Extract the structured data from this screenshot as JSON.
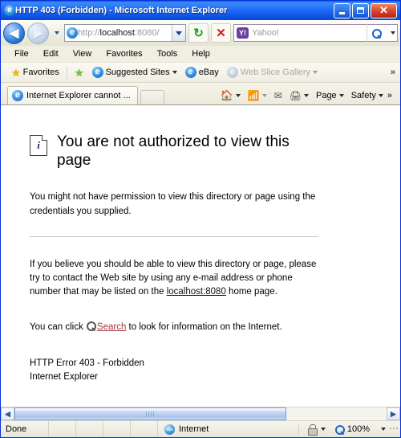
{
  "window": {
    "title": "HTTP 403 (Forbidden) - Microsoft Internet Explorer",
    "minimize_label": "Minimize",
    "maximize_label": "Maximize",
    "close_label": "Close"
  },
  "nav": {
    "back_glyph": "◀",
    "forward_glyph": "▶",
    "refresh_glyph": "↻",
    "stop_glyph": "✕",
    "address_prefix": "http://",
    "address_host": "localhost",
    "address_suffix": ":8080/"
  },
  "search": {
    "provider_badge": "Y!",
    "placeholder": "Yahoo!"
  },
  "menu": {
    "items": [
      "File",
      "Edit",
      "View",
      "Favorites",
      "Tools",
      "Help"
    ]
  },
  "favorites_bar": {
    "favorites_label": "Favorites",
    "items": [
      {
        "label": "Suggested Sites",
        "dim": false
      },
      {
        "label": "eBay",
        "dim": false
      },
      {
        "label": "Web Slice Gallery",
        "dim": true
      }
    ],
    "overflow_glyph": "»"
  },
  "tabs": {
    "active_tab_label": "Internet Explorer cannot ...",
    "new_tab_label": ""
  },
  "command_bar": {
    "home_label": "",
    "feeds_label": "",
    "mail_label": "",
    "print_label": "",
    "page_label": "Page",
    "safety_label": "Safety",
    "overflow_glyph": "»"
  },
  "page": {
    "heading": "You are not authorized to view this page",
    "paragraph_1": "You might not have permission to view this directory or page using the credentials you supplied.",
    "paragraph_2_before": "If you believe you should be able to view this directory or page, please try to contact the Web site by using any e-mail address or phone number that may be listed on the ",
    "paragraph_2_link": "localhost:8080",
    "paragraph_2_after": " home page.",
    "paragraph_3_before": "You can click ",
    "paragraph_3_link": "Search",
    "paragraph_3_after": " to look for information on the Internet.",
    "error_code": "HTTP Error 403 - Forbidden",
    "error_agent": "Internet Explorer"
  },
  "status_bar": {
    "status_text": "Done",
    "zone_label": "Internet",
    "zoom_level": "100%"
  }
}
